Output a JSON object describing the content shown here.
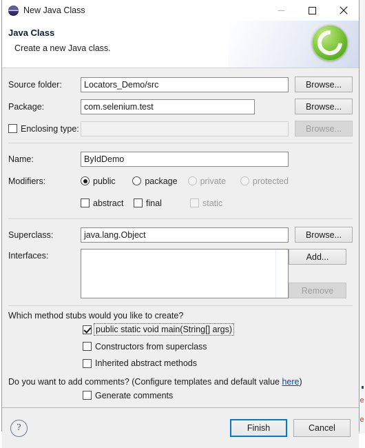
{
  "window": {
    "title": "New Java Class",
    "icon": "java-class-icon",
    "controls": {
      "minimize": "minimize-icon",
      "maximize": "maximize-icon",
      "close": "close-icon"
    }
  },
  "header": {
    "title": "Java Class",
    "description": "Create a new Java class.",
    "logo": "eclipse-green-c-logo"
  },
  "form": {
    "source_folder": {
      "label": "Source folder:",
      "value": "Locators_Demo/src",
      "browse_label": "Browse..."
    },
    "package": {
      "label": "Package:",
      "value": "com.selenium.test",
      "browse_label": "Browse..."
    },
    "enclosing_type": {
      "label": "Enclosing type:",
      "checked": false,
      "value": "",
      "placeholder": "",
      "browse_label": "Browse...",
      "disabled": true
    },
    "name": {
      "label": "Name:",
      "value": "ByIdDemo"
    },
    "modifiers": {
      "label": "Modifiers:",
      "access": [
        {
          "label": "public",
          "selected": true,
          "disabled": false
        },
        {
          "label": "package",
          "selected": false,
          "disabled": false
        },
        {
          "label": "private",
          "selected": false,
          "disabled": true
        },
        {
          "label": "protected",
          "selected": false,
          "disabled": true
        }
      ],
      "flags": [
        {
          "label": "abstract",
          "checked": false,
          "disabled": false
        },
        {
          "label": "final",
          "checked": false,
          "disabled": false
        },
        {
          "label": "static",
          "checked": false,
          "disabled": true
        }
      ]
    },
    "superclass": {
      "label": "Superclass:",
      "value": "java.lang.Object",
      "browse_label": "Browse..."
    },
    "interfaces": {
      "label": "Interfaces:",
      "items": [],
      "add_label": "Add...",
      "remove_label": "Remove",
      "remove_disabled": true
    },
    "stubs": {
      "question": "Which method stubs would you like to create?",
      "options": [
        {
          "label": "public static void main(String[] args)",
          "checked": true,
          "focused": true
        },
        {
          "label": "Constructors from superclass",
          "checked": false,
          "focused": false
        },
        {
          "label": "Inherited abstract methods",
          "checked": false,
          "focused": false
        }
      ]
    },
    "comments": {
      "question_prefix": "Do you want to add comments? (Configure templates and default value ",
      "link_label": "here",
      "question_suffix": ")",
      "option": {
        "label": "Generate comments",
        "checked": false
      }
    }
  },
  "footer": {
    "help_label": "?",
    "finish_label": "Finish",
    "cancel_label": "Cancel"
  },
  "colors": {
    "dialog_bg": "#efefef",
    "accent_focus": "#0078d7",
    "link": "#0645ad",
    "logo_green": "#7ec242",
    "disabled_text": "#9a9a9a"
  }
}
